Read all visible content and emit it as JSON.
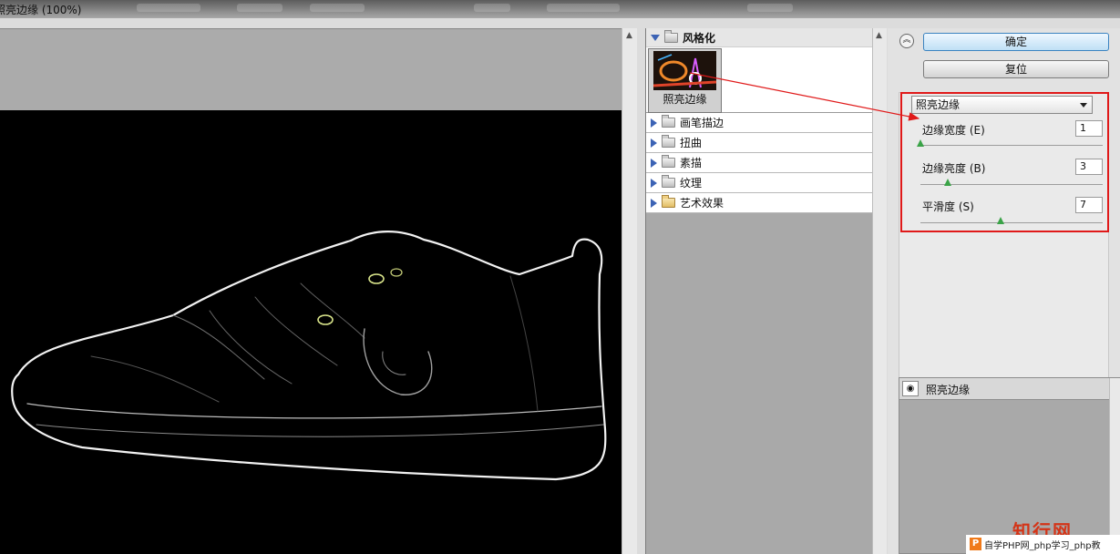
{
  "window": {
    "title": "照亮边缘 (100%)"
  },
  "gallery": {
    "open_category": "风格化",
    "thumbnail_caption": "照亮边缘",
    "categories": [
      "画笔描边",
      "扭曲",
      "素描",
      "纹理",
      "艺术效果"
    ]
  },
  "buttons": {
    "ok": "确定",
    "reset": "复位"
  },
  "filter_select": {
    "value": "照亮边缘"
  },
  "params": [
    {
      "label": "边缘宽度 (E)",
      "value": "1",
      "level": 0.0
    },
    {
      "label": "边缘亮度 (B)",
      "value": "3",
      "level": 0.15
    },
    {
      "label": "平滑度 (S)",
      "value": "7",
      "level": 0.44
    }
  ],
  "layers": {
    "name": "照亮边缘"
  },
  "watermark": {
    "brand": "知行网",
    "text": "自学PHP网_php学习_php教"
  },
  "colors": {
    "annotation_red": "#e01919",
    "slider_green": "#3aa347",
    "ok_blue": "#3b83c0"
  }
}
